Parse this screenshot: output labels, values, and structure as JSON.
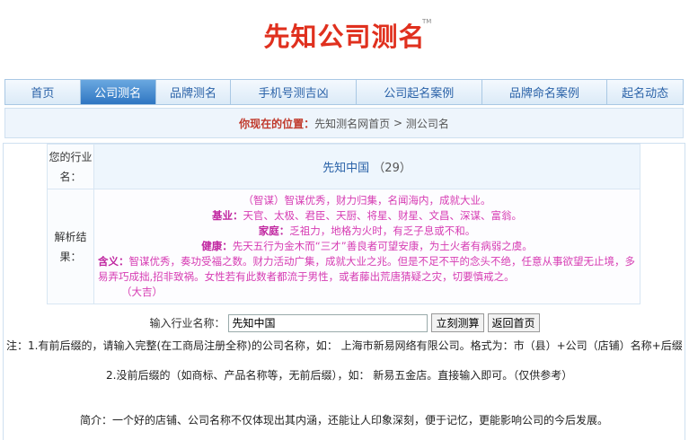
{
  "logo": {
    "text": "先知公司测名",
    "tm": "TM"
  },
  "nav": [
    {
      "label": "首页"
    },
    {
      "label": "公司测名"
    },
    {
      "label": "品牌测名"
    },
    {
      "label": "手机号测吉凶"
    },
    {
      "label": "公司起名案例"
    },
    {
      "label": "品牌命名案例"
    },
    {
      "label": "起名动态"
    }
  ],
  "breadcrumb": {
    "label": "你现在的位置：",
    "home": "先知测名网首页",
    "sep": " > ",
    "current": "测公司名"
  },
  "result": {
    "name_head": "您的行业名：",
    "name_value": "先知中国",
    "name_score": "（29）",
    "detail_head": "解析结果：",
    "line1": "（智谋）智谋优秀，财力归集，名闻海内，成就大业。",
    "line2_label": "基业：",
    "line2": "天官、太极、君臣、天厨、将星、财星、文昌、深谋、富翁。",
    "line3_label": "家庭：",
    "line3": "乏祖力，地格为火时，有乏子息或不和。",
    "line4_label": "健康：",
    "line4": "先天五行为金木而“三才”善良者可望安康，为土火者有病弱之虞。",
    "line5_label": "含义：",
    "line5": "智谋优秀，奏功受福之数。财力活动广集，成就大业之兆。但是不足不平的念头不绝，任意从事欲望无止境，多易弄巧成拙,招非致祸。女性若有此数者都流于男性，或者藤出荒唐猜疑之灾，切要慎戒之。",
    "line6": "（大吉）"
  },
  "form": {
    "label": "输入行业名称：",
    "value": "先知中国",
    "submit": "立刻测算",
    "back": "返回首页"
  },
  "notes": {
    "note1": "注：1.有前后缀的，请输入完整(在工商局注册全称)的公司名称，如： 上海市新易网络有限公司。格式为：市（县）+公司（店铺）名称+后缀",
    "note2": "2.没前后缀的（如商标、产品名称等，无前后缀），如： 新易五金店。直接输入即可。（仅供参考）",
    "intro": "简介：一个好的店铺、公司名称不仅体现出其内涵，还能让人印象深刻，便于记忆，更能影响公司的今后发展。"
  }
}
